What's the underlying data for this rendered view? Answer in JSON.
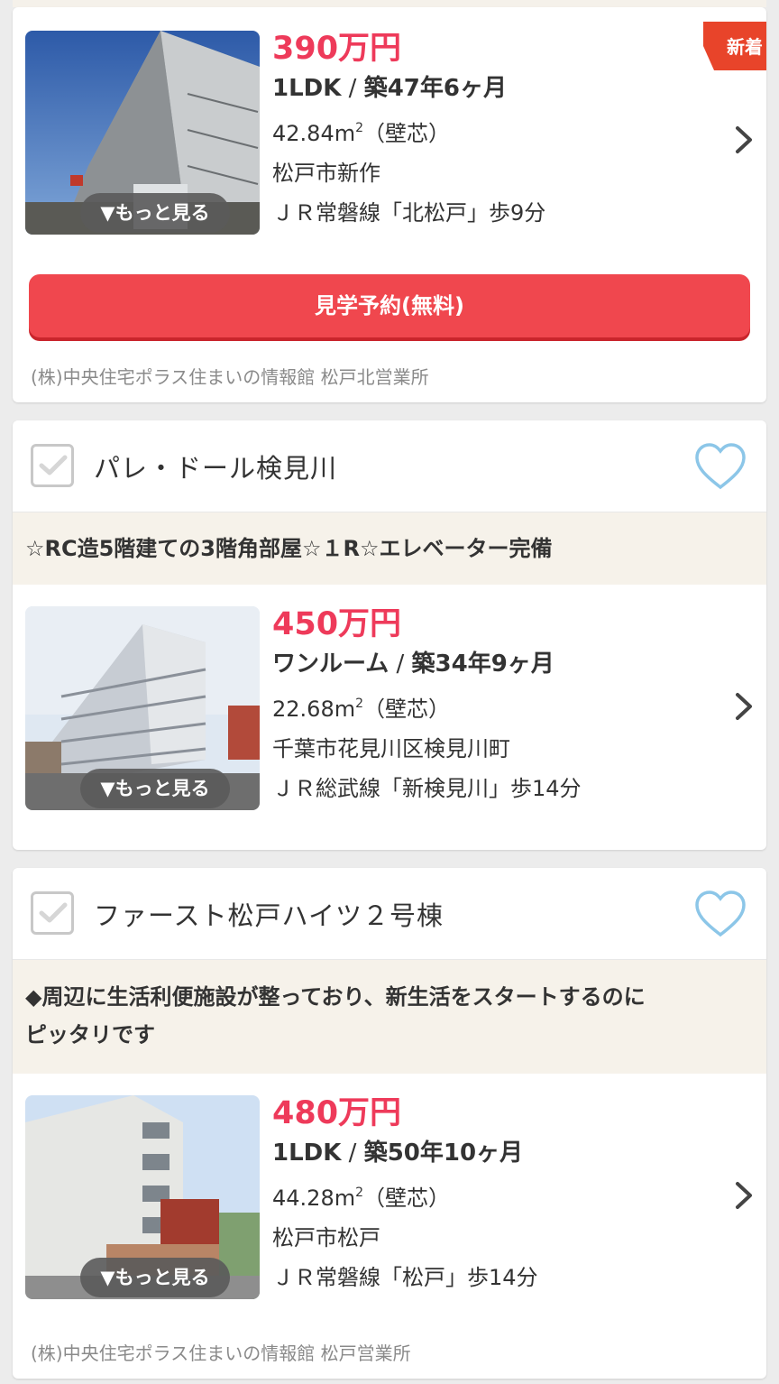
{
  "listings": [
    {
      "price": "390万円",
      "layout": "1LDK",
      "age": "築47年6ヶ月",
      "area": "42.84m",
      "area_sup": "2",
      "area_note": "（壁芯）",
      "address": "松戸市新作",
      "access": "ＪＲ常磐線「北松戸」歩9分",
      "more_label": "▼もっと見る",
      "badge": "新着",
      "reserve_label": "見学予約(無料)",
      "agent": "(株)中央住宅ポラス住まいの情報館 松戸北営業所"
    },
    {
      "name": "パレ・ドール検見川",
      "catch": "☆RC造5階建ての3階角部屋☆１R☆エレベーター完備",
      "price": "450万円",
      "layout": "ワンルーム",
      "age": "築34年9ヶ月",
      "area": "22.68m",
      "area_sup": "2",
      "area_note": "（壁芯）",
      "address": "千葉市花見川区検見川町",
      "access": "ＪＲ総武線「新検見川」歩14分",
      "more_label": "▼もっと見る"
    },
    {
      "name": "ファースト松戸ハイツ２号棟",
      "catch_line1": "◆周辺に生活利便施設が整っており、新生活をスタートするのに",
      "catch_line2": "ピッタリです",
      "price": "480万円",
      "layout": "1LDK",
      "age": "築50年10ヶ月",
      "area": "44.28m",
      "area_sup": "2",
      "area_note": "（壁芯）",
      "address": "松戸市松戸",
      "access": "ＪＲ常磐線「松戸」歩14分",
      "more_label": "▼もっと見る",
      "agent": "(株)中央住宅ポラス住まいの情報館 松戸営業所"
    }
  ],
  "layout_separator": " / ",
  "colors": {
    "price": "#ee3a5a",
    "reserve_button": "#f0474e",
    "badge": "#e8442a",
    "heart": "#8cc6e8",
    "catch_bg": "#f6f2ea"
  }
}
